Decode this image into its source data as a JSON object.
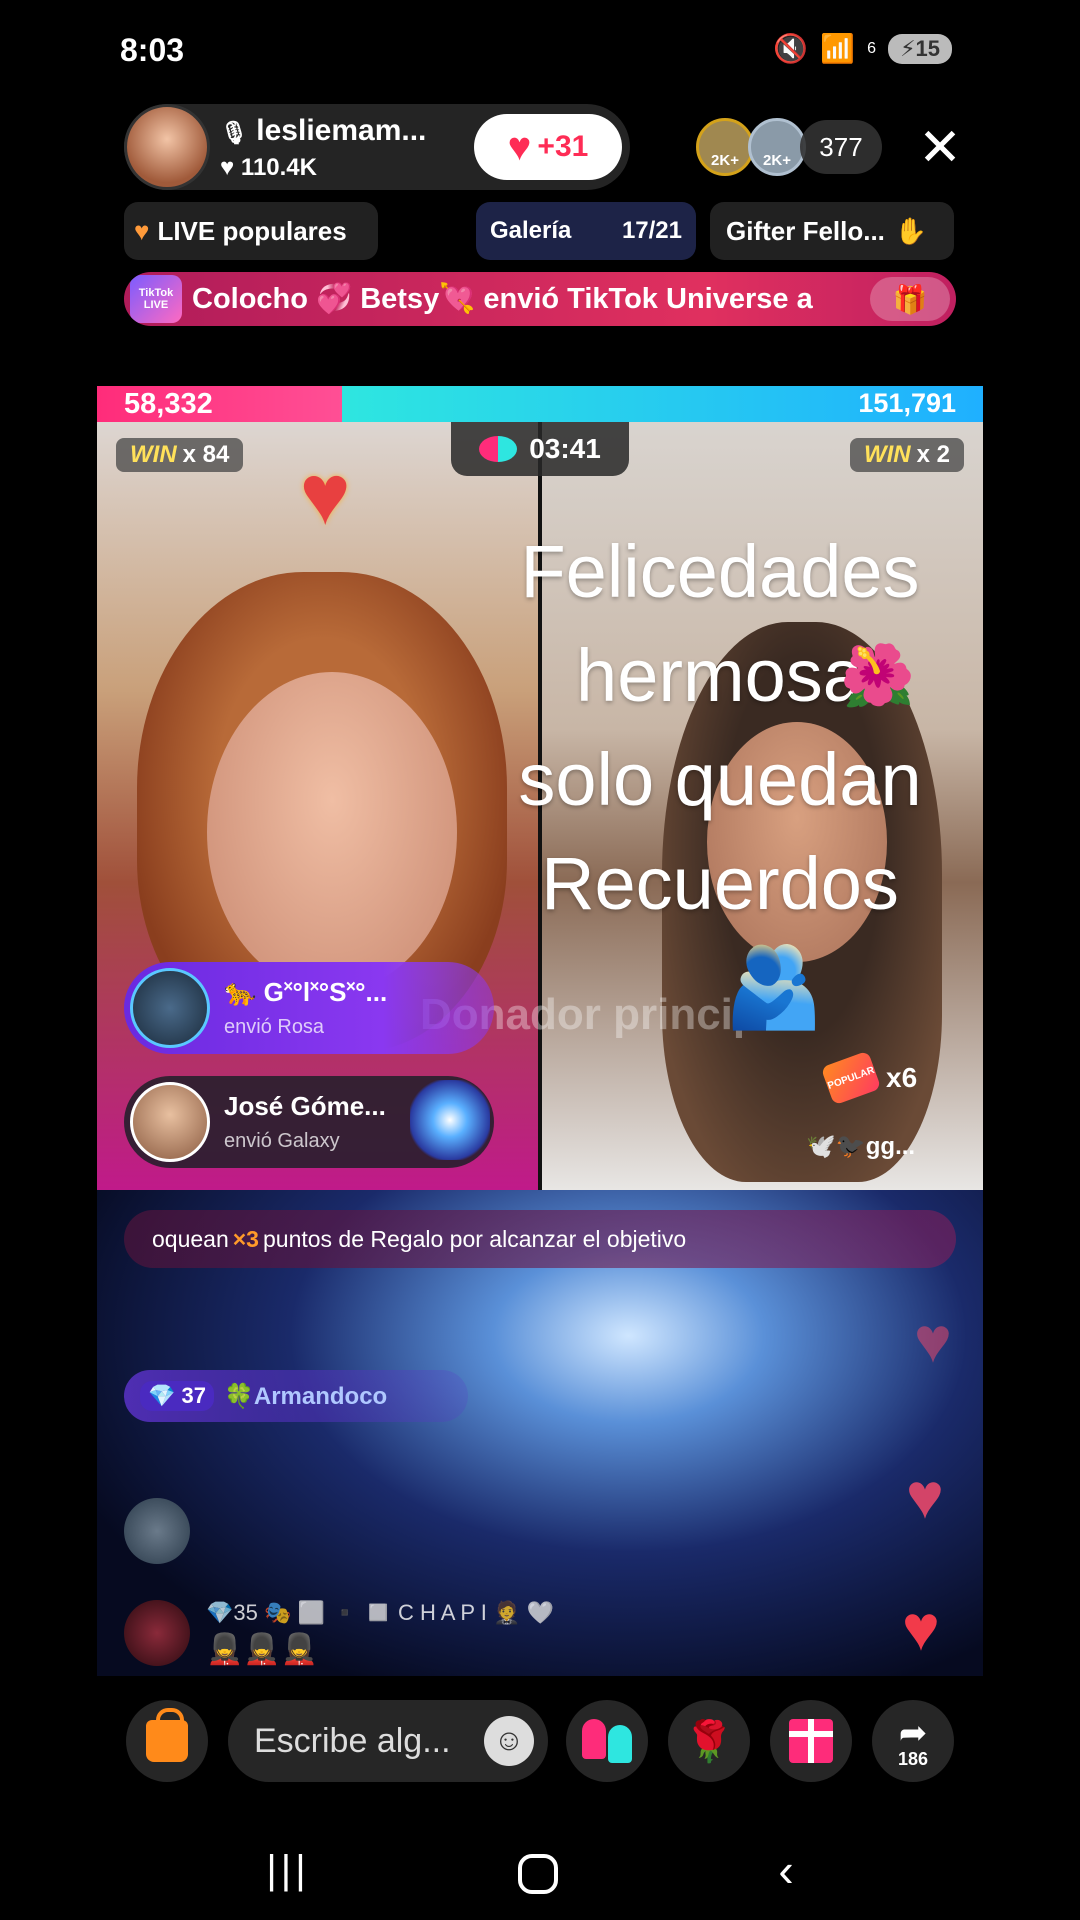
{
  "status_bar": {
    "time": "8:03",
    "signal": "6",
    "battery": "15"
  },
  "host": {
    "name": "lesliemam...",
    "likes": "110.4K",
    "follow_label": "+31"
  },
  "viewers": {
    "badge_1": "2K+",
    "badge_2": "2K+",
    "count": "377"
  },
  "chips": {
    "popular": "LIVE populares",
    "gallery_label": "Galería",
    "gallery_progress": "17/21",
    "gifter": "Gifter Fello..."
  },
  "gift_banner": {
    "badge": "TikTok LIVE",
    "text": "Colocho 💞 Betsy💘 envió TikTok Universe a"
  },
  "battle": {
    "score_left": "58,332",
    "score_right": "151,791",
    "timer": "03:41",
    "win_left_word": "WIN",
    "win_left_count": "x 84",
    "win_right_word": "WIN",
    "win_right_count": "x 2",
    "left_share": 0.277
  },
  "right_video": {
    "overlay_lines": [
      "Felicedades",
      "hermosa",
      "solo quedan",
      "Recuerdos"
    ],
    "ghost_text": "Donador principal",
    "popular_badge": "POPULAR",
    "popular_count": "x6",
    "tag": "🕊️🐦‍⬛gg..."
  },
  "gifters": [
    {
      "name": "🐆 G˟°l˟°S˟°...",
      "sub": "envió Rosa"
    },
    {
      "name": "José Góme...",
      "sub": "envió Galaxy"
    }
  ],
  "goal_banner": {
    "prefix": "oquean",
    "multiplier": "×3",
    "suffix": "puntos de Regalo por alcanzar el objetivo"
  },
  "comment_top": {
    "level": "💎 37",
    "name": "🍀Armandoco"
  },
  "chat": {
    "level": "💎35",
    "line2": "🎭 ⬜ ▪️ ◻️ C H A P I 🤵 🤍",
    "emojis": "💂‍♀️💂‍♀️💂‍♀️"
  },
  "toolbar": {
    "comment_placeholder": "Escribe alg...",
    "share_count": "186"
  },
  "colors": {
    "accent": "#fe2c55",
    "battle_left": "#ff2c7a",
    "battle_right": "#2ee6e0"
  }
}
